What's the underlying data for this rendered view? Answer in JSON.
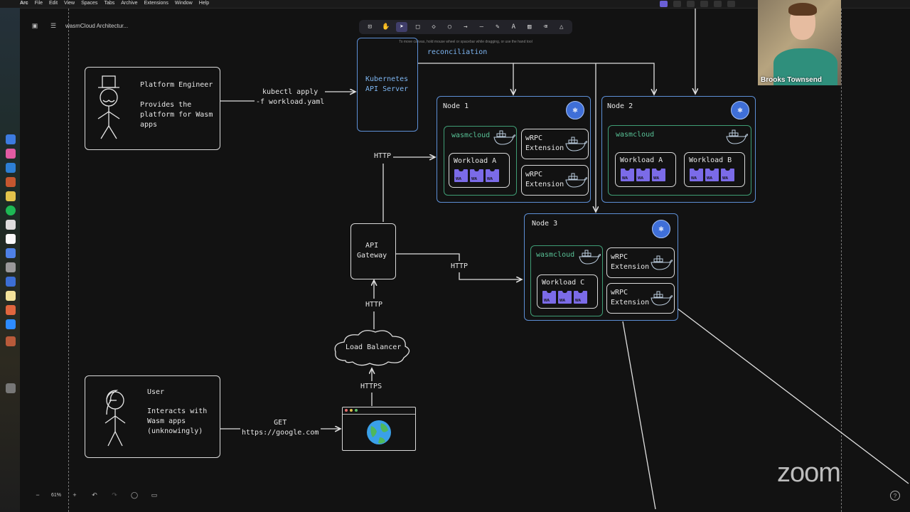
{
  "menubar": {
    "app": "Arc",
    "items": [
      "File",
      "Edit",
      "View",
      "Spaces",
      "Tabs",
      "Archive",
      "Extensions",
      "Window",
      "Help"
    ]
  },
  "document": {
    "title": "wasmCloud Architectur..."
  },
  "toolbar": {
    "tools": [
      "lock-icon",
      "hand-icon",
      "pointer-icon",
      "rectangle-icon",
      "diamond-icon",
      "ellipse-icon",
      "arrow-icon",
      "line-icon",
      "pencil-icon",
      "text-icon",
      "image-icon",
      "eraser-icon",
      "shapes-icon"
    ],
    "active_tool": "pointer-icon"
  },
  "hint": "To move canvas, hold mouse wheel or spacebar while dragging, or use the hand tool",
  "diagram": {
    "platform_engineer": {
      "title": "Platform Engineer",
      "desc": "Provides the\nplatform for Wasm\napps"
    },
    "kubectl_label": "kubectl apply\n-f workload.yaml",
    "k8s_api": "Kubernetes\nAPI Server",
    "reconciliation": "reconciliation",
    "node1": {
      "label": "Node 1",
      "wasmcloud": "wasmcloud",
      "workload": "Workload A",
      "ext1": "wRPC\nExtension",
      "ext2": "wRPC\nExtension"
    },
    "node2": {
      "label": "Node 2",
      "wasmcloud": "wasmcloud",
      "workload_a": "Workload A",
      "workload_b": "Workload B"
    },
    "node3": {
      "label": "Node 3",
      "wasmcloud": "wasmcloud",
      "workload": "Workload C",
      "ext1": "wRPC\nExtension",
      "ext2": "wRPC\nExtension"
    },
    "wa_badge": "WA",
    "http_top": "HTTP",
    "api_gateway": "API\nGateway",
    "http_right": "HTTP",
    "http_mid": "HTTP",
    "load_balancer": "Load Balancer",
    "https": "HTTPS",
    "user": {
      "title": "User",
      "desc": "Interacts with\nWasm apps\n(unknowingly)"
    },
    "get_label": "GET\nhttps://google.com"
  },
  "video": {
    "name": "Brooks Townsend"
  },
  "zoom_watermark": "zoom",
  "zoom_level": "61%",
  "colors": {
    "canvas": "#121212",
    "blue": "#5d8fd6",
    "green": "#3f9d75",
    "wa": "#7b6be8",
    "k8s": "#3f6fd8"
  }
}
